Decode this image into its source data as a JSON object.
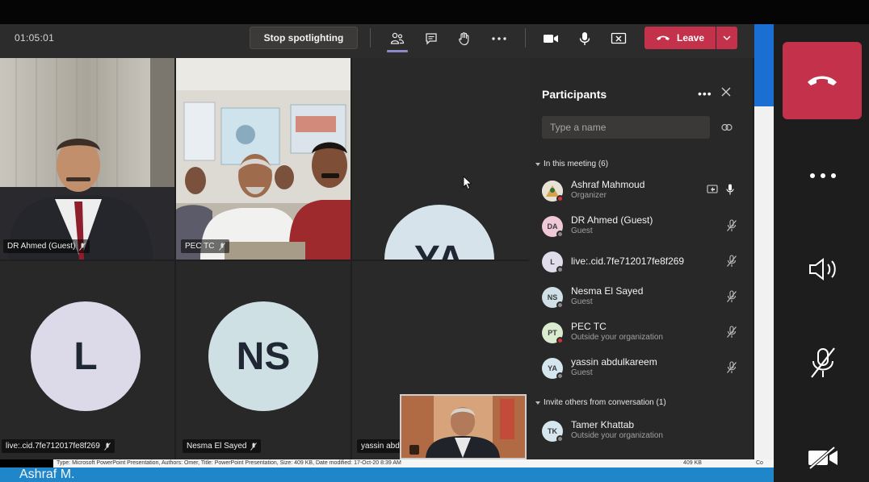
{
  "meeting": {
    "timer": "01:05:01",
    "spotlight_button": "Stop spotlighting",
    "leave_label": "Leave"
  },
  "toolbar_icons": [
    "people-icon",
    "chat-icon",
    "raise-hand-icon",
    "more-icon",
    "camera-icon",
    "microphone-icon",
    "share-tray-icon"
  ],
  "colors": {
    "leave_red": "#c4314b",
    "active_indicator": "#8b8cc7",
    "panel_bg": "#292828"
  },
  "tiles": [
    {
      "name": "DR Ahmed (Guest)",
      "kind": "video"
    },
    {
      "name": "PEC TC",
      "kind": "video"
    },
    {
      "initials": "YA",
      "kind": "avatar"
    },
    {
      "initials": "L",
      "name": "live:.cid.7fe712017fe8f269",
      "kind": "avatar"
    },
    {
      "initials": "NS",
      "name": "Nesma El Sayed",
      "kind": "avatar"
    },
    {
      "name": "yassin abdulkareem",
      "kind": "avatar-caption"
    }
  ],
  "participants_panel": {
    "title": "Participants",
    "search_placeholder": "Type a name",
    "in_meeting_label": "In this meeting (6)",
    "in_meeting": [
      {
        "initials": "",
        "name": "Ashraf Mahmoud",
        "sub": "Organizer",
        "status": "red",
        "avatar_bg": "#e8e2d6"
      },
      {
        "initials": "DA",
        "name": "DR Ahmed (Guest)",
        "sub": "Guest",
        "status": "grey",
        "avatar_bg": "#f0c9d8"
      },
      {
        "initials": "L",
        "name": "live:.cid.7fe712017fe8f269",
        "sub": "",
        "status": "grey",
        "avatar_bg": "#e0dcec"
      },
      {
        "initials": "NS",
        "name": "Nesma El Sayed",
        "sub": "Guest",
        "status": "grey",
        "avatar_bg": "#cfe0e6"
      },
      {
        "initials": "PT",
        "name": "PEC TC",
        "sub": "Outside your organization",
        "status": "red",
        "avatar_bg": "#d9ecd0"
      },
      {
        "initials": "YA",
        "name": "yassin abdulkareem",
        "sub": "Guest",
        "status": "grey",
        "avatar_bg": "#d5e6ee"
      }
    ],
    "invite_label": "Invite others from conversation (1)",
    "invite": [
      {
        "initials": "TK",
        "name": "Tamer Khattab",
        "sub": "Outside your organization",
        "status": "grey",
        "avatar_bg": "#d5e6ee"
      }
    ]
  },
  "desktop": {
    "status_text": "Type: Microsoft PowerPoint Presentation, Authors: Omer, Title: PowerPoint Presentation, Size: 409 KB, Date modified: 17-Oct-20 8:39 AM",
    "status_size": "409 KB",
    "status_cut": "Co",
    "bottom_caption": "Ashraf M."
  }
}
